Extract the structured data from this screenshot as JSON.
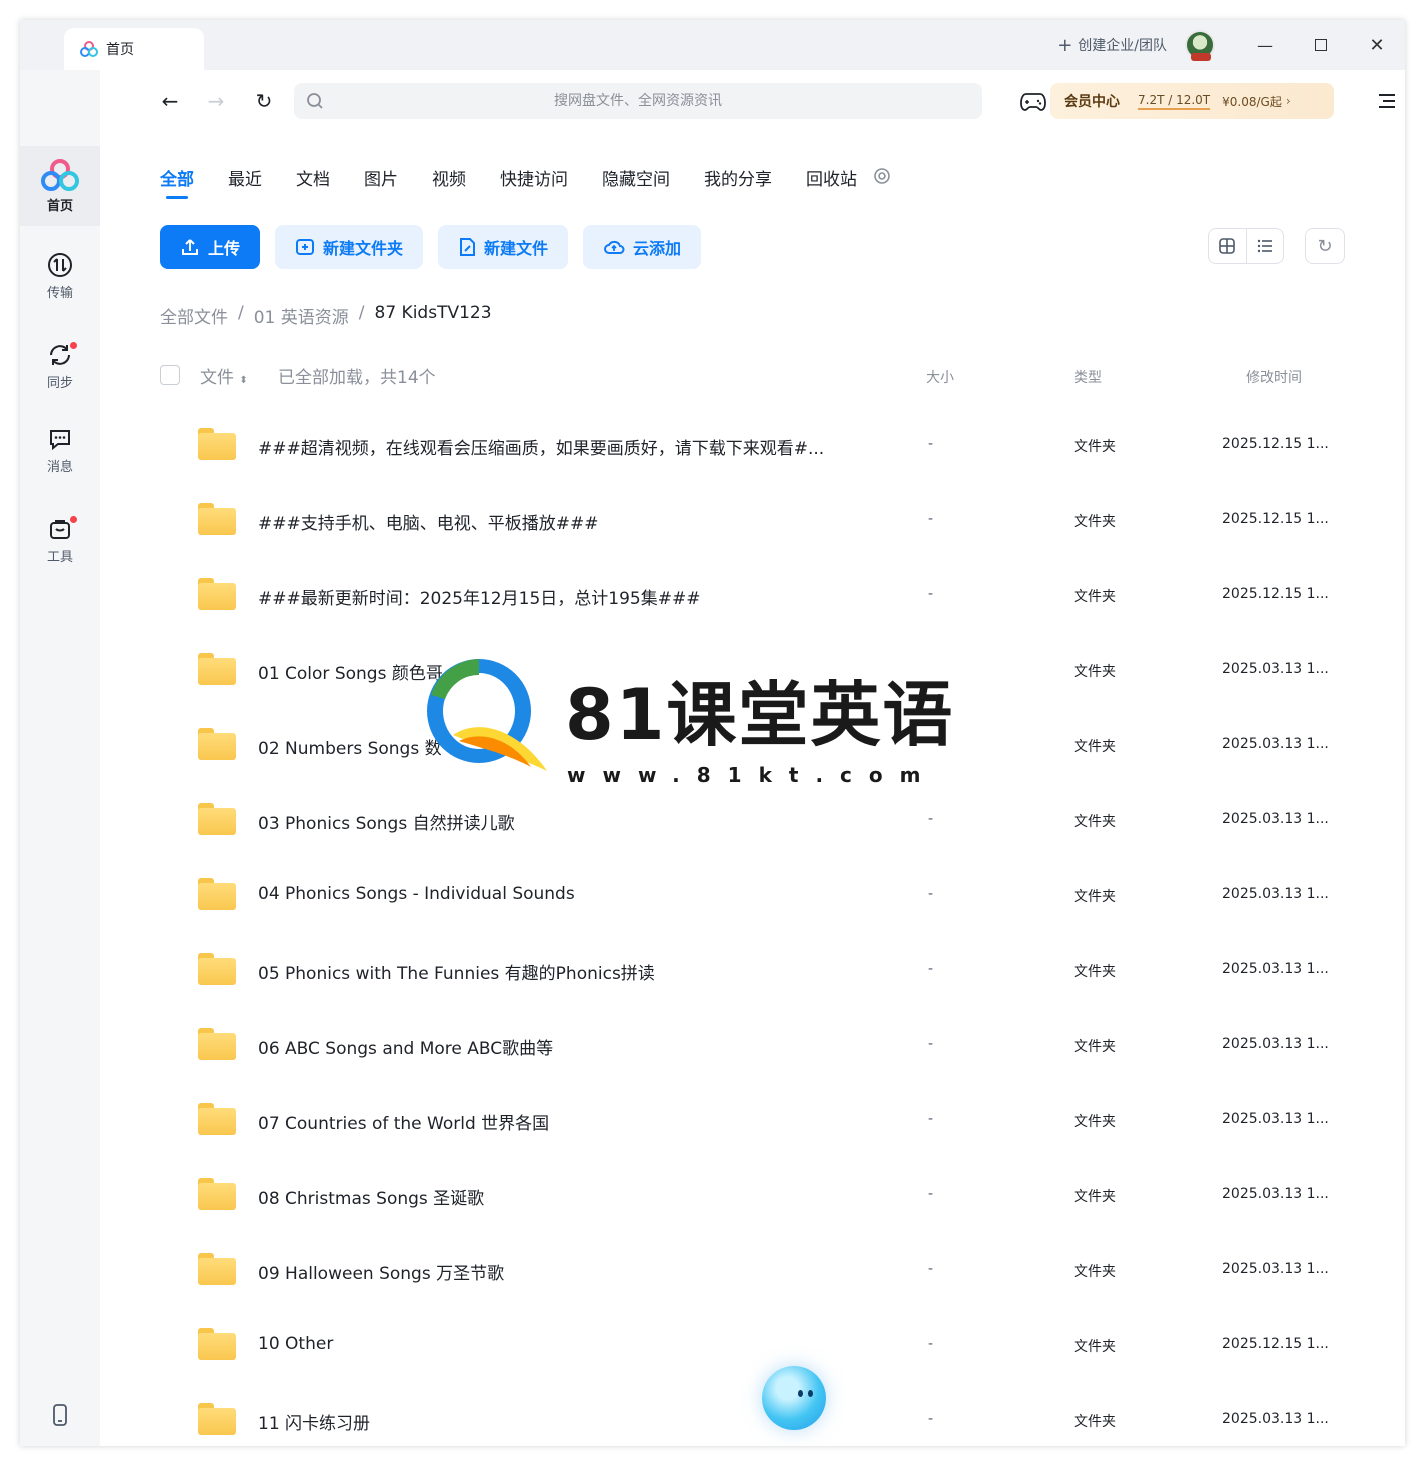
{
  "window": {
    "tab_label": "首页",
    "create_team": "创建企业/团队"
  },
  "sidebar": {
    "items": [
      {
        "label": "首页",
        "icon": "baidu-netdisk-logo-icon",
        "active": true
      },
      {
        "label": "传输",
        "icon": "transfer-icon"
      },
      {
        "label": "同步",
        "icon": "sync-icon",
        "badge": true
      },
      {
        "label": "消息",
        "icon": "message-icon"
      },
      {
        "label": "工具",
        "icon": "toolbox-icon",
        "badge": true
      }
    ]
  },
  "toolbar": {
    "search_placeholder": "搜网盘文件、全网资源资讯",
    "vip_title": "会员中心",
    "vip_capacity": "7.2T / 12.0T",
    "vip_price": "¥0.08/G起"
  },
  "categories": [
    "全部",
    "最近",
    "文档",
    "图片",
    "视频",
    "快捷访问",
    "隐藏空间",
    "我的分享",
    "回收站"
  ],
  "actions": {
    "upload": "上传",
    "new_folder": "新建文件夹",
    "new_file": "新建文件",
    "cloud_add": "云添加"
  },
  "breadcrumb": {
    "root": "全部文件",
    "parent": "01 英语资源",
    "current": "87 KidsTV123"
  },
  "table": {
    "col_file": "文件",
    "loaded": "已全部加载，共14个",
    "col_size": "大小",
    "col_type": "类型",
    "col_time": "修改时间",
    "rows": [
      {
        "name": "###超清视频，在线观看会压缩画质，如果要画质好，请下载下来观看#...",
        "size": "-",
        "type": "文件夹",
        "time": "2025.12.15 1..."
      },
      {
        "name": "###支持手机、电脑、电视、平板播放###",
        "size": "-",
        "type": "文件夹",
        "time": "2025.12.15 1..."
      },
      {
        "name": "###最新更新时间：2025年12月15日，总计195集###",
        "size": "-",
        "type": "文件夹",
        "time": "2025.12.15 1..."
      },
      {
        "name": "01 Color Songs 颜色哥",
        "size": "",
        "type": "文件夹",
        "time": "2025.03.13 1..."
      },
      {
        "name": "02 Numbers Songs 数",
        "size": "",
        "type": "文件夹",
        "time": "2025.03.13 1..."
      },
      {
        "name": "03 Phonics Songs 自然拼读儿歌",
        "size": "-",
        "type": "文件夹",
        "time": "2025.03.13 1..."
      },
      {
        "name": "04 Phonics Songs - Individual Sounds",
        "size": "-",
        "type": "文件夹",
        "time": "2025.03.13 1..."
      },
      {
        "name": "05 Phonics with The Funnies 有趣的Phonics拼读",
        "size": "-",
        "type": "文件夹",
        "time": "2025.03.13 1..."
      },
      {
        "name": "06 ABC Songs and More ABC歌曲等",
        "size": "-",
        "type": "文件夹",
        "time": "2025.03.13 1..."
      },
      {
        "name": "07 Countries of the World 世界各国",
        "size": "-",
        "type": "文件夹",
        "time": "2025.03.13 1..."
      },
      {
        "name": "08 Christmas Songs 圣诞歌",
        "size": "-",
        "type": "文件夹",
        "time": "2025.03.13 1..."
      },
      {
        "name": "09 Halloween Songs 万圣节歌",
        "size": "-",
        "type": "文件夹",
        "time": "2025.03.13 1..."
      },
      {
        "name": "10 Other",
        "size": "-",
        "type": "文件夹",
        "time": "2025.12.15 1..."
      },
      {
        "name": "11 闪卡练习册",
        "size": "-",
        "type": "文件夹",
        "time": "2025.03.13 1..."
      }
    ]
  },
  "watermark": {
    "text": "81课堂英语",
    "url": "www.81kt.com"
  },
  "colors": {
    "accent": "#0d7bf5",
    "folder": "#f9c74f",
    "badge": "#f5424d"
  }
}
